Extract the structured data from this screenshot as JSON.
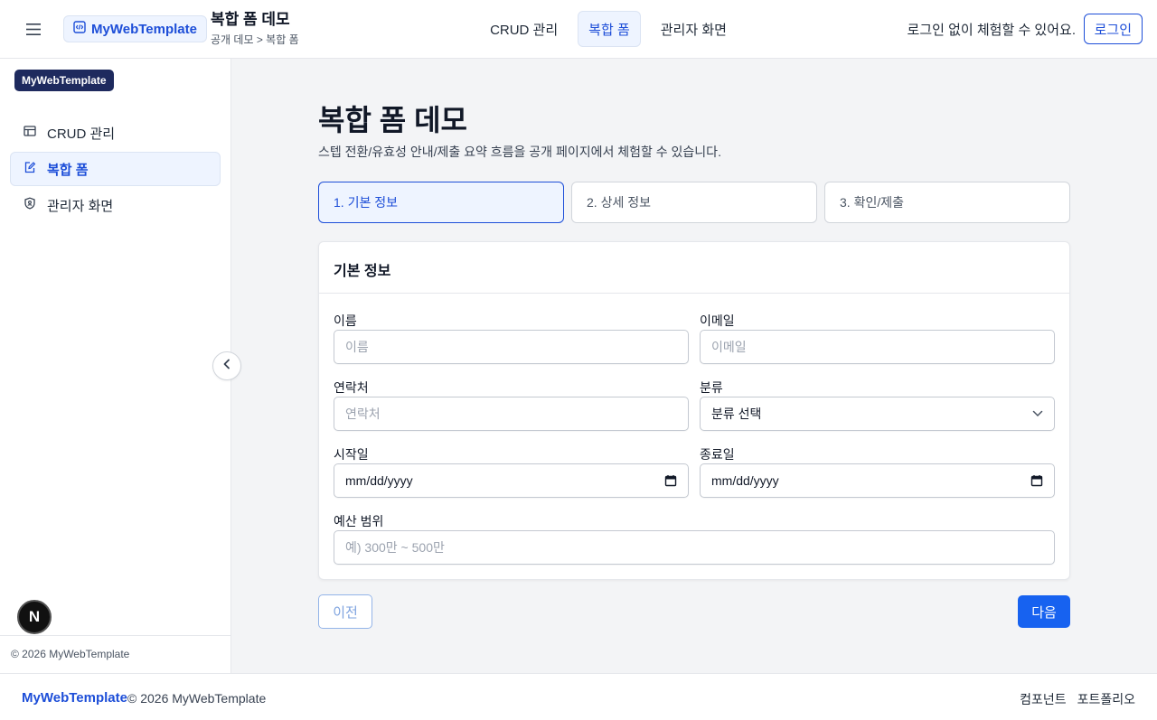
{
  "header": {
    "brand": "MyWebTemplate",
    "page_title": "복합 폼 데모",
    "breadcrumb": "공개 데모 > 복합 폼",
    "nav": [
      {
        "label": "CRUD 관리",
        "active": false
      },
      {
        "label": "복합 폼",
        "active": true
      },
      {
        "label": "관리자 화면",
        "active": false
      }
    ],
    "login_hint": "로그인 없이 체험할 수 있어요.",
    "login_button": "로그인"
  },
  "sidebar": {
    "badge": "MyWebTemplate",
    "items": [
      {
        "label": "CRUD 관리",
        "icon": "table-icon",
        "active": false
      },
      {
        "label": "복합 폼",
        "icon": "edit-form-icon",
        "active": true
      },
      {
        "label": "관리자 화면",
        "icon": "shield-user-icon",
        "active": false
      }
    ],
    "footer": "© 2026 MyWebTemplate",
    "dev_badge": "N"
  },
  "main": {
    "title": "복합 폼 데모",
    "description": "스텝 전환/유효성 안내/제출 요약 흐름을 공개 페이지에서 체험할 수 있습니다.",
    "steps": [
      {
        "label": "1. 기본 정보",
        "active": true
      },
      {
        "label": "2. 상세 정보",
        "active": false
      },
      {
        "label": "3. 확인/제출",
        "active": false
      }
    ],
    "card_title": "기본 정보",
    "fields": {
      "name": {
        "label": "이름",
        "placeholder": "이름"
      },
      "email": {
        "label": "이메일",
        "placeholder": "이메일"
      },
      "phone": {
        "label": "연락처",
        "placeholder": "연락처"
      },
      "category": {
        "label": "분류",
        "value": "분류 선택"
      },
      "start_date": {
        "label": "시작일",
        "value": "mm/dd/yyyy"
      },
      "end_date": {
        "label": "종료일",
        "value": "mm/dd/yyyy"
      },
      "budget": {
        "label": "예산 범위",
        "placeholder": "예) 300만 ~ 500만"
      }
    },
    "prev_button": "이전",
    "next_button": "다음"
  },
  "footer": {
    "brand": "MyWebTemplate",
    "copyright": "© 2026 MyWebTemplate",
    "links": [
      "컴포넌트",
      "포트폴리오"
    ]
  },
  "colors": {
    "accent": "#1d4ed8",
    "primary_button": "#1762f0",
    "active_bg": "#eef4ff",
    "sidebar_badge": "#1e2a5e"
  }
}
